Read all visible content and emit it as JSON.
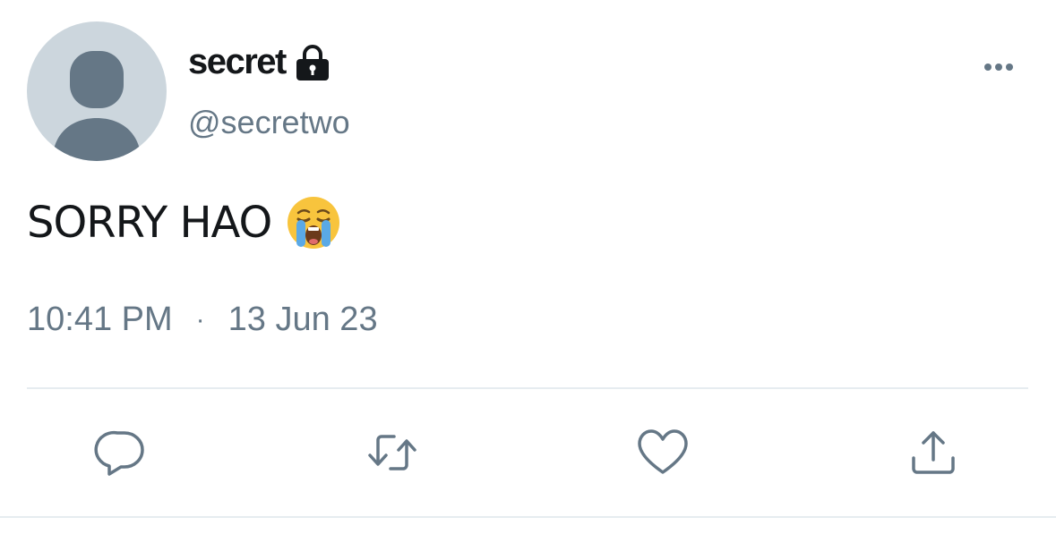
{
  "user": {
    "display_name": "secret",
    "handle": "@secretwo",
    "protected_icon": "lock-icon"
  },
  "tweet": {
    "text": "SORRY HAO",
    "emoji": "loudly-crying-face-emoji",
    "time": "10:41 PM",
    "separator": "·",
    "date": "13 Jun 23"
  },
  "actions": [
    "reply-icon",
    "retweet-icon",
    "like-icon",
    "share-icon"
  ],
  "colors": {
    "text": "#14171a",
    "muted": "#657786",
    "avatar_bg": "#ccd6dd",
    "avatar_figure": "#657786",
    "divider": "#e6ecf0"
  }
}
